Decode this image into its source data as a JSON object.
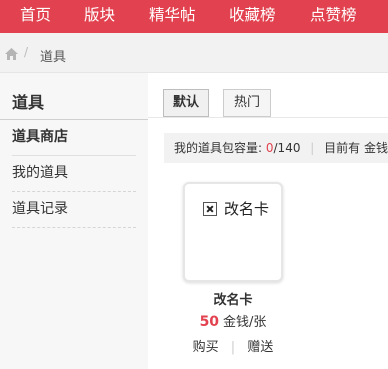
{
  "colors": {
    "brand": "#e2424f",
    "price": "#e2424f"
  },
  "topnav": {
    "items": [
      {
        "label": "首页"
      },
      {
        "label": "版块"
      },
      {
        "label": "精华帖"
      },
      {
        "label": "收藏榜"
      },
      {
        "label": "点赞榜"
      }
    ]
  },
  "breadcrumb": {
    "home_icon": "home-icon",
    "separator": "/",
    "current": "道具"
  },
  "sidebar": {
    "title": "道具",
    "items": [
      {
        "label": "道具商店",
        "active": true
      },
      {
        "label": "我的道具",
        "active": false
      },
      {
        "label": "道具记录",
        "active": false
      }
    ]
  },
  "tabs": [
    {
      "label": "默认",
      "active": true
    },
    {
      "label": "热门",
      "active": false
    }
  ],
  "capacity": {
    "label": "我的道具包容量:",
    "used": "0",
    "total": "/140",
    "divider": "|",
    "money_text": "目前有 金钱"
  },
  "item": {
    "image_alt": "改名卡",
    "name": "改名卡",
    "price": "50",
    "unit": "金钱/张",
    "buy_label": "购买",
    "divider": "|",
    "gift_label": "赠送"
  }
}
